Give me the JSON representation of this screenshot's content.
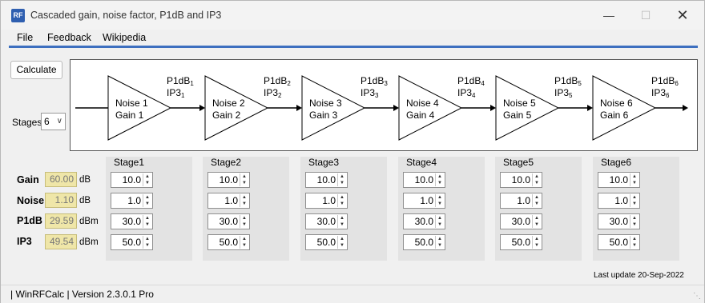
{
  "window": {
    "app_icon": "RF",
    "title": "Cascaded gain, noise factor, P1dB and IP3",
    "minimize_icon": "minimize-icon",
    "maximize_icon": "maximize-icon",
    "close_icon": "close-icon"
  },
  "menu": [
    "File",
    "Feedback",
    "Wikipedia"
  ],
  "controls": {
    "calculate_label": "Calculate",
    "stages_label": "Stages",
    "stages_value": "6"
  },
  "diagram": {
    "stages": [
      {
        "noise": "Noise 1",
        "gain": "Gain  1",
        "p1db": "P1dB",
        "ip3": "IP3",
        "sub": "1"
      },
      {
        "noise": "Noise 2",
        "gain": "Gain  2",
        "p1db": "P1dB",
        "ip3": "IP3",
        "sub": "2"
      },
      {
        "noise": "Noise 3",
        "gain": "Gain  3",
        "p1db": "P1dB",
        "ip3": "IP3",
        "sub": "3"
      },
      {
        "noise": "Noise 4",
        "gain": "Gain  4",
        "p1db": "P1dB",
        "ip3": "IP3",
        "sub": "4"
      },
      {
        "noise": "Noise 5",
        "gain": "Gain  5",
        "p1db": "P1dB",
        "ip3": "IP3",
        "sub": "5"
      },
      {
        "noise": "Noise 6",
        "gain": "Gain  6",
        "p1db": "P1dB",
        "ip3": "IP3",
        "sub": "6"
      }
    ]
  },
  "results": [
    {
      "label": "Gain",
      "value": "60.00",
      "unit": "dB"
    },
    {
      "label": "Noise",
      "value": "1.10",
      "unit": "dB"
    },
    {
      "label": "P1dB",
      "value": "29.59",
      "unit": "dBm"
    },
    {
      "label": "IP3",
      "value": "49.54",
      "unit": "dBm"
    }
  ],
  "stages": [
    {
      "title": "Stage1",
      "values": [
        "10.0",
        "1.0",
        "30.0",
        "50.0"
      ]
    },
    {
      "title": "Stage2",
      "values": [
        "10.0",
        "1.0",
        "30.0",
        "50.0"
      ]
    },
    {
      "title": "Stage3",
      "values": [
        "10.0",
        "1.0",
        "30.0",
        "50.0"
      ]
    },
    {
      "title": "Stage4",
      "values": [
        "10.0",
        "1.0",
        "30.0",
        "50.0"
      ]
    },
    {
      "title": "Stage5",
      "values": [
        "10.0",
        "1.0",
        "30.0",
        "50.0"
      ]
    },
    {
      "title": "Stage6",
      "values": [
        "10.0",
        "1.0",
        "30.0",
        "50.0"
      ]
    }
  ],
  "footer": {
    "last_update": "Last update 20-Sep-2022",
    "status": "| WinRFCalc | Version 2.3.0.1 Pro"
  },
  "colors": {
    "accent": "#3d6fbf",
    "result_bg": "#efe6a8",
    "panel_bg": "#e3e3e3"
  }
}
